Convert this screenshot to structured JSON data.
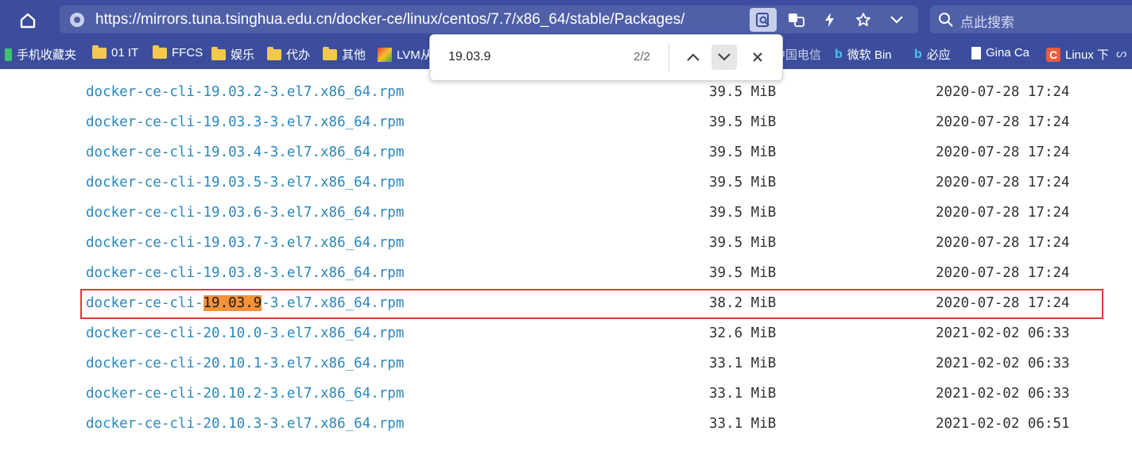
{
  "browser": {
    "url": "https://mirrors.tuna.tsinghua.edu.cn/docker-ce/linux/centos/7.7/x86_64/stable/Packages/",
    "search_placeholder": "点此搜索"
  },
  "bookmarks": [
    {
      "label": "手机收藏夹",
      "icon": "phone-icon"
    },
    {
      "label": "01 IT",
      "icon": "folder-icon"
    },
    {
      "label": "FFCS",
      "icon": "folder-icon"
    },
    {
      "label": "娱乐",
      "icon": "folder-icon"
    },
    {
      "label": "代办",
      "icon": "folder-icon"
    },
    {
      "label": "其他",
      "icon": "folder-icon"
    },
    {
      "label": "LVM从",
      "icon": "site-icon"
    },
    {
      "label": "中国电信",
      "icon": "site-icon"
    },
    {
      "label": "微软 Bin",
      "icon": "bing-icon"
    },
    {
      "label": "必应",
      "icon": "bing-icon"
    },
    {
      "label": "Gina Ca",
      "icon": "page-icon"
    },
    {
      "label": "Linux 下",
      "icon": "c-icon"
    }
  ],
  "find": {
    "query": "19.03.9",
    "count": "2/2"
  },
  "packages": [
    {
      "name": "docker-ce-cli-19.03.2-3.el7.x86_64.rpm",
      "size": "39.5 MiB",
      "date": "2020-07-28 17:24"
    },
    {
      "name": "docker-ce-cli-19.03.3-3.el7.x86_64.rpm",
      "size": "39.5 MiB",
      "date": "2020-07-28 17:24"
    },
    {
      "name": "docker-ce-cli-19.03.4-3.el7.x86_64.rpm",
      "size": "39.5 MiB",
      "date": "2020-07-28 17:24"
    },
    {
      "name": "docker-ce-cli-19.03.5-3.el7.x86_64.rpm",
      "size": "39.5 MiB",
      "date": "2020-07-28 17:24"
    },
    {
      "name": "docker-ce-cli-19.03.6-3.el7.x86_64.rpm",
      "size": "39.5 MiB",
      "date": "2020-07-28 17:24"
    },
    {
      "name": "docker-ce-cli-19.03.7-3.el7.x86_64.rpm",
      "size": "39.5 MiB",
      "date": "2020-07-28 17:24"
    },
    {
      "name": "docker-ce-cli-19.03.8-3.el7.x86_64.rpm",
      "size": "39.5 MiB",
      "date": "2020-07-28 17:24"
    },
    {
      "name_prefix": "docker-ce-cli-",
      "name_match": "19.03.9",
      "name_suffix": "-3.el7.x86_64.rpm",
      "size": "38.2 MiB",
      "date": "2020-07-28 17:24"
    },
    {
      "name": "docker-ce-cli-20.10.0-3.el7.x86_64.rpm",
      "size": "32.6 MiB",
      "date": "2021-02-02 06:33"
    },
    {
      "name": "docker-ce-cli-20.10.1-3.el7.x86_64.rpm",
      "size": "33.1 MiB",
      "date": "2021-02-02 06:33"
    },
    {
      "name": "docker-ce-cli-20.10.2-3.el7.x86_64.rpm",
      "size": "33.1 MiB",
      "date": "2021-02-02 06:33"
    },
    {
      "name": "docker-ce-cli-20.10.3-3.el7.x86_64.rpm",
      "size": "33.1 MiB",
      "date": "2021-02-02 06:51"
    }
  ],
  "colors": {
    "chrome": "#3b4d9c",
    "link": "#2a87bf",
    "match_highlight": "#f5923a",
    "annotation_box": "#e53935"
  }
}
